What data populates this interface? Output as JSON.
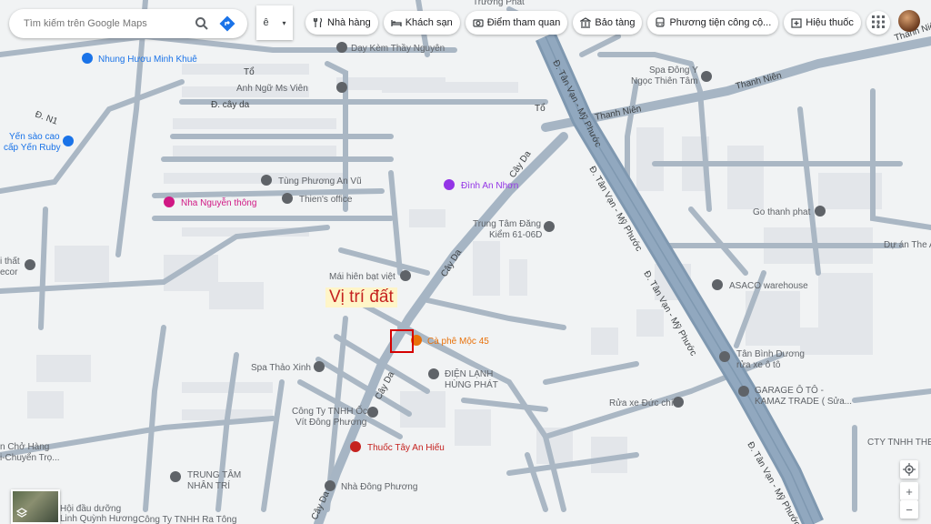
{
  "search": {
    "placeholder": "Tìm kiếm trên Google Maps"
  },
  "lang_toggle": {
    "label": "ê"
  },
  "chips": [
    {
      "label": "Nhà hàng",
      "icon": "fork-knife-icon"
    },
    {
      "label": "Khách sạn",
      "icon": "bed-icon"
    },
    {
      "label": "Điểm tham quan",
      "icon": "camera-icon"
    },
    {
      "label": "Bảo tàng",
      "icon": "museum-icon"
    },
    {
      "label": "Phương tiện công cộ...",
      "icon": "bus-icon"
    },
    {
      "label": "Hiệu thuốc",
      "icon": "pharmacy-icon"
    }
  ],
  "annotation": {
    "text": "Vị trí đất"
  },
  "streets": {
    "thanh_nien_1": "Thanh Niên",
    "thanh_nien_2": "Thanh Niên",
    "thanh_nien_3": "Thanh Niên",
    "tan_van_1": "Đ. Tân Vạn - Mỹ Phước",
    "tan_van_2": "Đ. Tân Vạn - Mỹ Phước",
    "tan_van_3": "Đ. Tân Vạn - Mỹ Phước",
    "tan_van_4": "Đ. Tân Vạn - Mỹ Phước",
    "cay_da_1": "Cây Da",
    "cay_da_2": "Cây Da",
    "cay_da_3": "Cây Da",
    "cay_da_4": "Cây Da",
    "cay_da_5": "Đ. cây da",
    "to_1": "Tổ",
    "to_2": "Tổ",
    "d_n1": "Đ. N1"
  },
  "pois": {
    "truong_phat": "Trương Phát",
    "day_kem": "Dạy Kèm Thầy Nguyên",
    "nhung_huou": "Nhung Hươu Minh Khuê",
    "anh_ngu": "Anh Ngữ Ms Viên",
    "spa_dong_y_1": "Spa Đông Y",
    "spa_dong_y_2": "Ngọc Thiên Tâm",
    "yen_sao_1": "Yến sào cao",
    "yen_sao_2": "cấp Yến Ruby",
    "tung_phuong": "Tùng Phương An Vũ",
    "dinh_an_nhon": "Đình An Nhơn",
    "nha_nguyen": "Nha Nguyễn thông",
    "thiens_office": "Thien's office",
    "go_thanh_phat": "Go thanh phat",
    "trung_tam_dk_1": "Trung Tâm Đăng",
    "trung_tam_dk_2": "Kiểm 61-06D",
    "du_an": "Dự án The A",
    "noi_that_1": "i thất",
    "noi_that_2": "ecor",
    "mai_hien": "Mái hiên bạt việt",
    "asaco": "ASACO warehouse",
    "ca_phe": "Cà phê Mộc 45",
    "tan_binh_duong_1": "Tân Bình Dương",
    "tan_binh_duong_2": "rửa xe ô tô",
    "spa_thao": "Spa Thảo Xinh",
    "dien_lanh_1": "ĐIỆN LẠNH",
    "dien_lanh_2": "HÙNG PHÁT",
    "garage_1": "GARAGE Ô TÔ -",
    "garage_2": "KAMAZ TRADE ( Sửa...",
    "rua_xe": "Rửa xe Đức chí",
    "cong_ty_oc_1": "Công Ty TNHH Ốc",
    "cong_ty_oc_2": "Vít Đông Phương",
    "thuoc_tay": "Thuốc Tây An Hiếu",
    "cty_tnhh": "CTY TNHH THE",
    "cho_hang_1": "n Chở Hàng",
    "cho_hang_2": "i-Chuyển Trọ...",
    "trung_tam_nhan_tri_1": "TRUNG TÂM",
    "trung_tam_nhan_tri_2": "NHÂN TRÍ",
    "nha_dong_phuong": "Nhà Đông Phương",
    "hoi_dau_duong_1": "Hội đầu dưỡng",
    "hoi_dau_duong_2": "Linh Quỳnh Hương",
    "cong_ty_ra": "Công Ty TNHH Ra Tông"
  },
  "colors": {
    "background": "#f1f3f4",
    "road": "#aab7c4",
    "road_outline": "#98a8b8",
    "highway": "#8da4bb",
    "building": "#e3e6ea",
    "marker": "#d50000",
    "annotation_text": "#c5221f",
    "annotation_bg": "#fff5c8"
  }
}
